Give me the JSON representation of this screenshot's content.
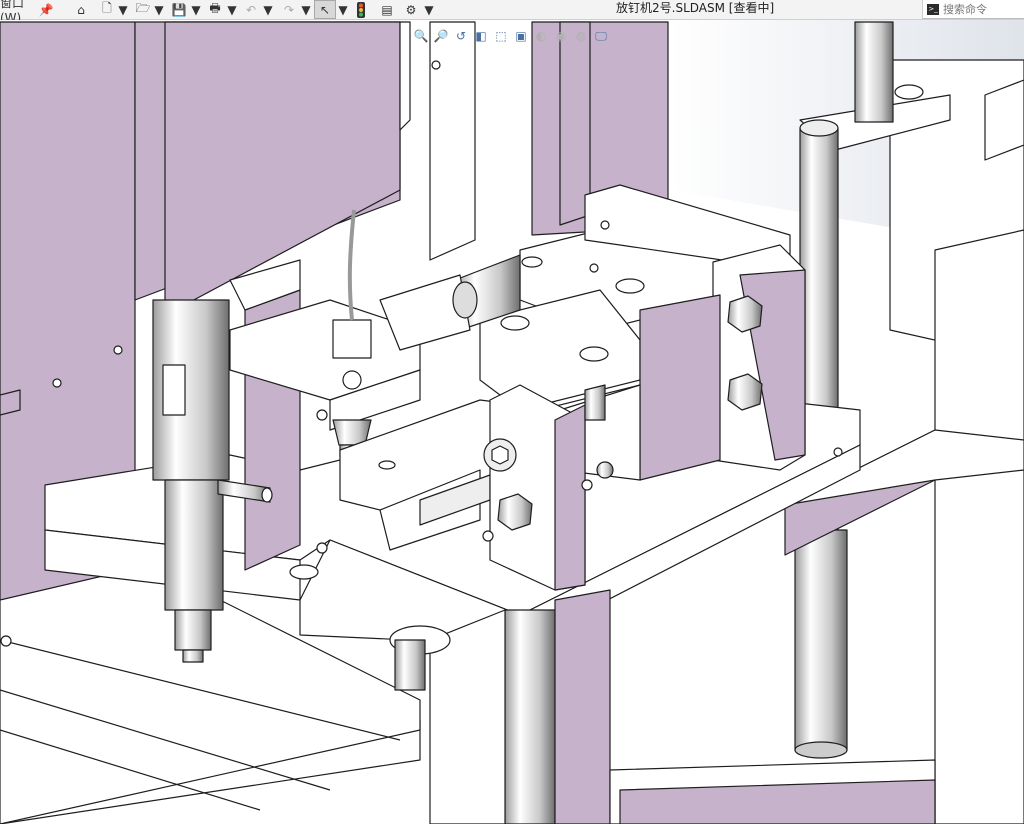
{
  "toolbar": {
    "window_menu": "窗口(W)",
    "icons": [
      "pin-icon",
      "home-icon",
      "new-document-icon",
      "open-folder-icon",
      "save-icon",
      "print-icon",
      "undo-icon",
      "redo-icon",
      "select-cursor-icon",
      "traffic-light-icon",
      "file-properties-icon",
      "options-gear-icon"
    ]
  },
  "title": "放钉机2号.SLDASM [查看中]",
  "command_search": {
    "placeholder": "搜索命令"
  },
  "heads_up_toolbar": {
    "icons": [
      "zoom-to-fit-icon",
      "zoom-area-icon",
      "previous-view-icon",
      "section-view-icon",
      "view-orientation-icon",
      "display-style-icon",
      "hide-show-icon",
      "edit-appearance-icon",
      "apply-scene-icon",
      "view-settings-icon"
    ]
  },
  "colors": {
    "part_lilac": "#c6b3cb",
    "part_white": "#ffffff",
    "edge": "#1e1e1e",
    "toolbar_bg": "#f3f3f3"
  }
}
